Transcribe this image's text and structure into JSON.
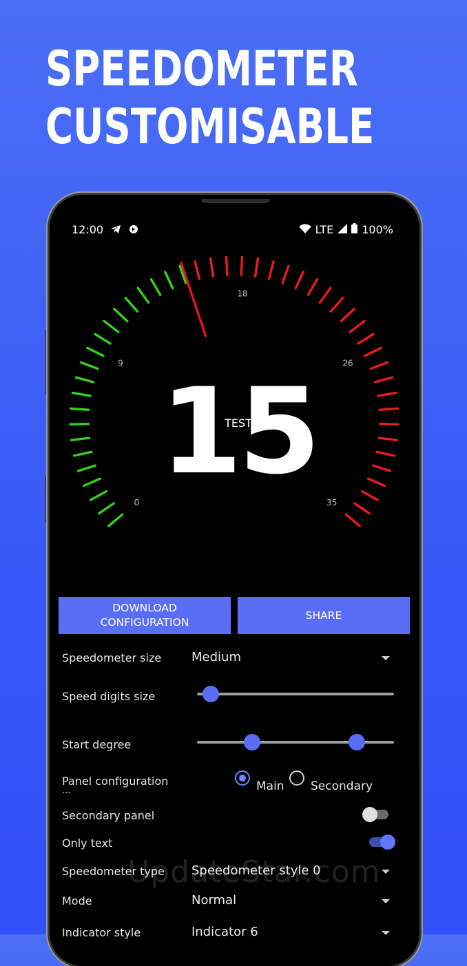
{
  "headline": {
    "line1": "SPEEDOMETER",
    "line2": "CUSTOMISABLE"
  },
  "status_bar": {
    "time": "12:00",
    "network": "LTE",
    "battery": "100%"
  },
  "gauge": {
    "speed": "15",
    "center_label": "TEST",
    "needle_value": 15,
    "max_value": 35,
    "tick_labels": [
      "0",
      "9",
      "18",
      "26",
      "35"
    ],
    "active_color": "#35d21a",
    "inactive_color": "#ee1b1b",
    "needle_color": "#e01515"
  },
  "buttons": {
    "download": "DOWNLOAD\nCONFIGURATION",
    "share": "SHARE"
  },
  "settings": {
    "speedometer_size": {
      "label": "Speedometer size",
      "value": "Medium"
    },
    "speed_digits_size": {
      "label": "Speed digits size",
      "level": 0.07
    },
    "start_degree": {
      "label": "Start degree",
      "low": 0.28,
      "high": 0.81
    },
    "panel_configuration": {
      "label": "Panel configuration",
      "ellipsis": "...",
      "options": [
        "Main",
        "Secondary"
      ],
      "selected": "Main"
    },
    "secondary_panel": {
      "label": "Secondary panel",
      "enabled": false
    },
    "only_text": {
      "label": "Only text",
      "enabled": true
    },
    "speedometer_type": {
      "label": "Speedometer type",
      "value": "Speedometer style 0"
    },
    "mode": {
      "label": "Mode",
      "value": "Normal"
    },
    "indicator_style": {
      "label": "Indicator style",
      "value": "Indicator 6"
    }
  },
  "accent_color": "#5a6ef5",
  "watermark": "UpdateStar.com"
}
